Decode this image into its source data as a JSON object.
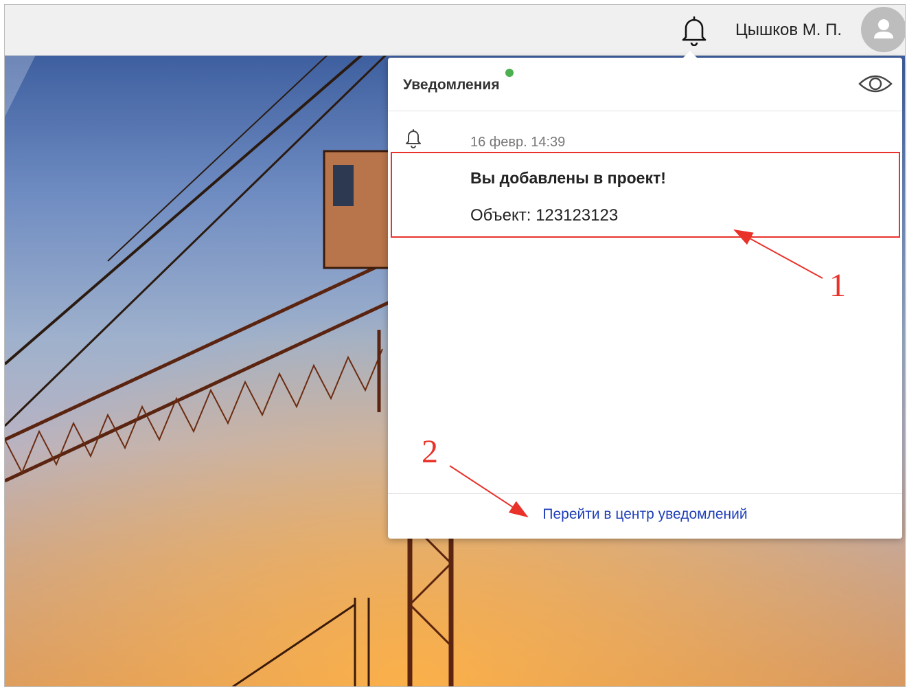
{
  "header": {
    "user_name": "Цышков М. П.",
    "bell_icon": "bell-icon",
    "avatar_icon": "user-icon"
  },
  "notifications_popup": {
    "title": "Уведомления",
    "has_unread_indicator": true,
    "indicator_color": "#4caf50",
    "mark_read_icon": "eye-icon",
    "items": [
      {
        "icon": "bell-icon",
        "date": "16 февр. 14:39",
        "title": "Вы добавлены в проект!",
        "body": "Объект: 123123123"
      }
    ],
    "footer_link": "Перейти в центр уведомлений",
    "link_color": "#1f3fb8"
  },
  "annotations": {
    "color": "#e8322a",
    "labels": [
      "1",
      "2"
    ]
  }
}
